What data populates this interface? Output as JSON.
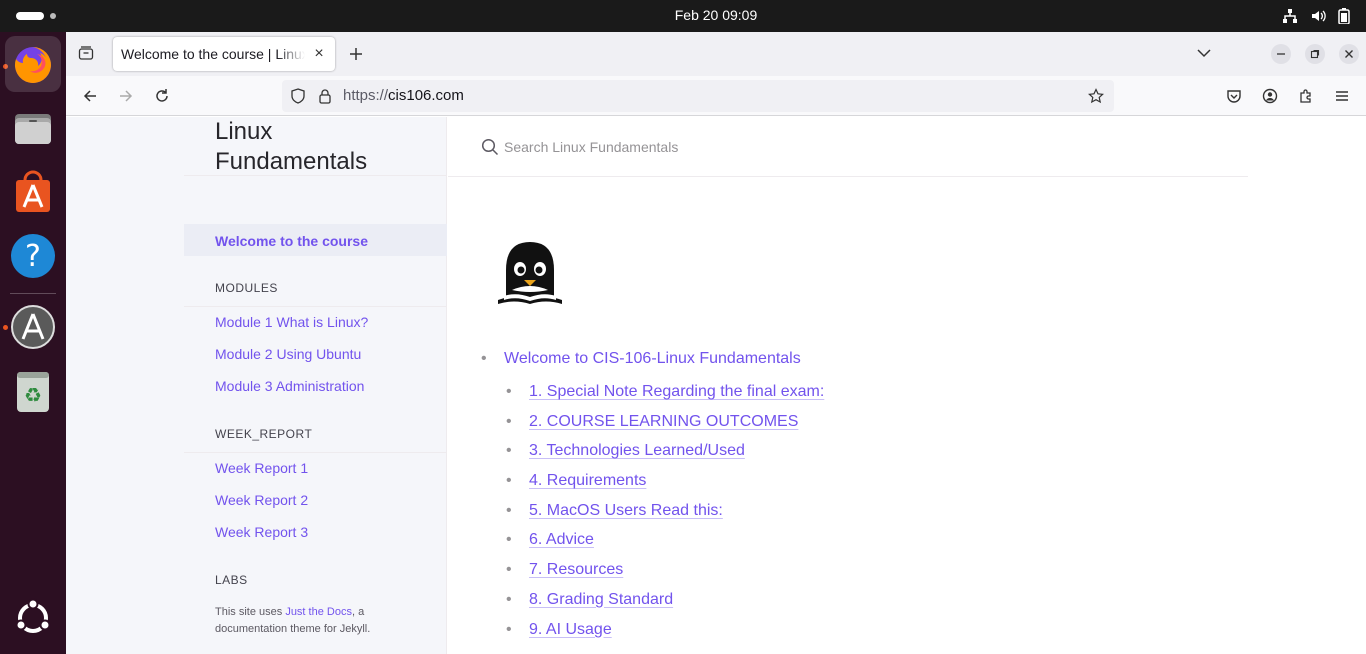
{
  "system": {
    "clock": "Feb 20  09:09"
  },
  "dock": {
    "apps": [
      "firefox-icon",
      "files-icon",
      "app-center-icon",
      "help-icon",
      "software-updater-icon",
      "trash-icon",
      "show-apps-icon"
    ]
  },
  "browser": {
    "tab_title": "Welcome to the course | Linux Fundamentals",
    "url_prefix": "https://",
    "url_domain": "cis106.com"
  },
  "sidebar": {
    "site_title": "Linux Fundamentals",
    "active_item": "Welcome to the course",
    "sections": [
      {
        "title": "MODULES",
        "items": [
          "Module 1 What is Linux?",
          "Module 2 Using Ubuntu",
          "Module 3 Administration"
        ]
      },
      {
        "title": "WEEK_REPORT",
        "items": [
          "Week Report 1",
          "Week Report 2",
          "Week Report 3"
        ]
      },
      {
        "title": "LABS",
        "items": []
      }
    ],
    "footer_prefix": "This site uses ",
    "footer_link": "Just the Docs",
    "footer_suffix": ", a documentation theme for Jekyll."
  },
  "search": {
    "placeholder": "Search Linux Fundamentals"
  },
  "content": {
    "toc_title": "Welcome to CIS-106-Linux Fundamentals",
    "toc_items": [
      "1. Special Note Regarding the final exam:",
      "2. COURSE LEARNING OUTCOMES",
      "3. Technologies Learned/Used",
      "4. Requirements",
      "5. MacOS Users Read this:",
      "6. Advice",
      "7. Resources",
      "8. Grading Standard",
      "9. AI Usage"
    ]
  },
  "colors": {
    "link": "#7253ed",
    "dock_bg": "#2c0f22",
    "ubuntu_orange": "#e95420"
  }
}
